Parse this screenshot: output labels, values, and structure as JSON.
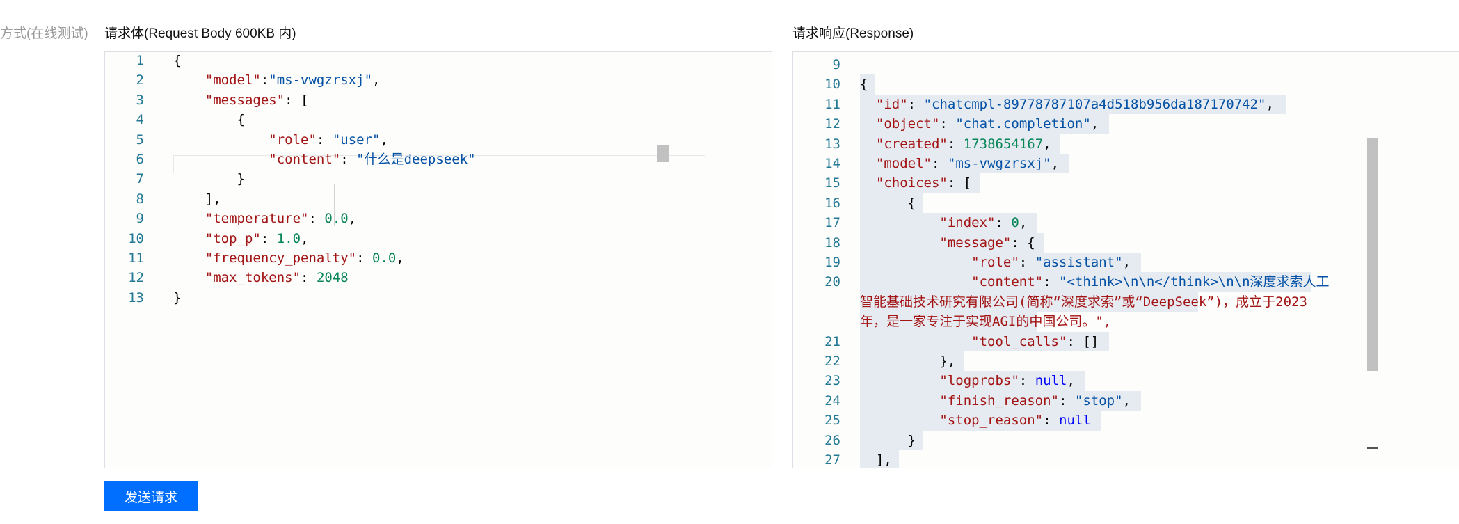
{
  "side_label": "方式(在线测试)",
  "request": {
    "title": "请求体(Request Body 600KB 内)",
    "lines": [
      {
        "n": "1",
        "text": "{"
      },
      {
        "n": "2",
        "text": "    \"model\":\"ms-vwgzrsxj\","
      },
      {
        "n": "3",
        "text": "    \"messages\": ["
      },
      {
        "n": "4",
        "text": "        {"
      },
      {
        "n": "5",
        "text": "            \"role\": \"user\","
      },
      {
        "n": "6",
        "text": "            \"content\": \"什么是deepseek\""
      },
      {
        "n": "7",
        "text": "        }"
      },
      {
        "n": "8",
        "text": "    ],"
      },
      {
        "n": "9",
        "text": "    \"temperature\": 0.0,"
      },
      {
        "n": "10",
        "text": "    \"top_p\": 1.0,"
      },
      {
        "n": "11",
        "text": "    \"frequency_penalty\": 0.0,"
      },
      {
        "n": "12",
        "text": "    \"max_tokens\": 2048"
      },
      {
        "n": "13",
        "text": "}"
      }
    ]
  },
  "response": {
    "title": "请求响应(Response)",
    "lines": [
      {
        "n": "9",
        "text": ""
      },
      {
        "n": "10",
        "text": "{"
      },
      {
        "n": "11",
        "text": "  \"id\": \"chatcmpl-89778787107a4d518b956da187170742\","
      },
      {
        "n": "12",
        "text": "  \"object\": \"chat.completion\","
      },
      {
        "n": "13",
        "text": "  \"created\": 1738654167,"
      },
      {
        "n": "14",
        "text": "  \"model\": \"ms-vwgzrsxj\","
      },
      {
        "n": "15",
        "text": "  \"choices\": ["
      },
      {
        "n": "16",
        "text": "      {"
      },
      {
        "n": "17",
        "text": "          \"index\": 0,"
      },
      {
        "n": "18",
        "text": "          \"message\": {"
      },
      {
        "n": "19",
        "text": "              \"role\": \"assistant\","
      },
      {
        "n": "20",
        "text": "              \"content\": \"<think>\\n\\n</think>\\n\\n深度求索人工"
      },
      {
        "n": "",
        "text": "智能基础技术研究有限公司(简称“深度求索”或“DeepSeek”)，成立于2023"
      },
      {
        "n": "",
        "text": "年，是一家专注于实现AGI的中国公司。\","
      },
      {
        "n": "21",
        "text": "              \"tool_calls\": []"
      },
      {
        "n": "22",
        "text": "          },"
      },
      {
        "n": "23",
        "text": "          \"logprobs\": null,"
      },
      {
        "n": "24",
        "text": "          \"finish_reason\": \"stop\","
      },
      {
        "n": "25",
        "text": "          \"stop_reason\": null"
      },
      {
        "n": "26",
        "text": "      }"
      },
      {
        "n": "27",
        "text": "  ],"
      }
    ]
  },
  "send_button": "发送请求",
  "colors": {
    "accent": "#006eff",
    "line_number": "#237893",
    "key": "#a31515",
    "string": "#0451a5",
    "number": "#098658",
    "null": "#0000ff"
  }
}
